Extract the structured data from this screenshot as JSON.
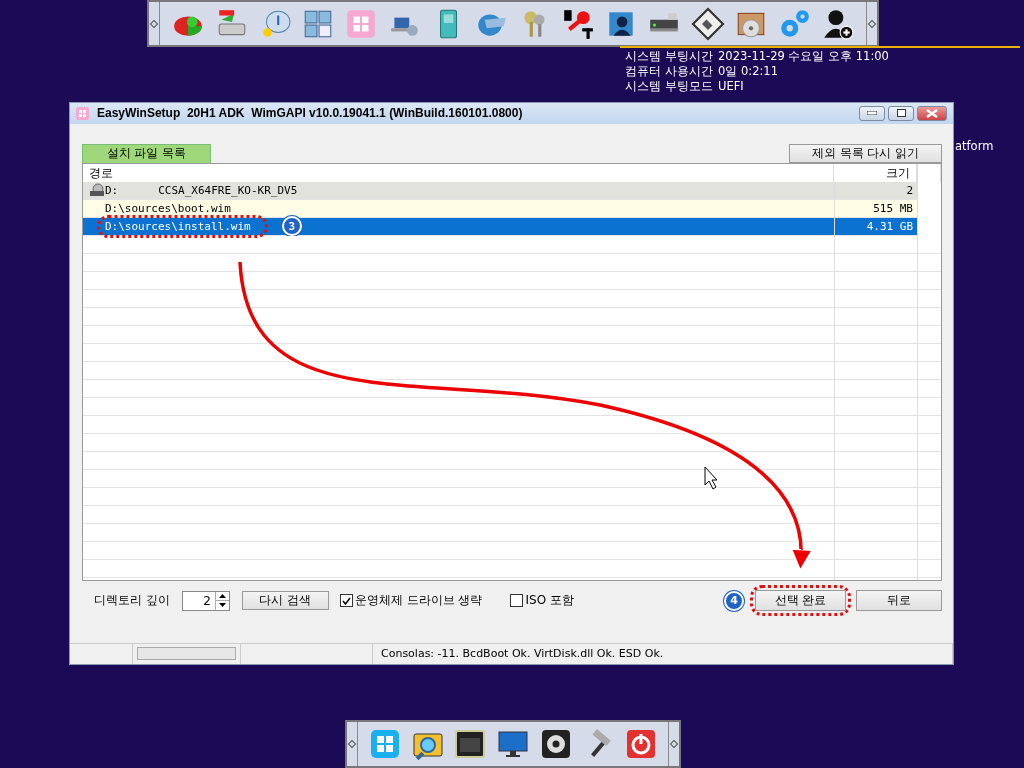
{
  "system_info": [
    {
      "label": "시스템 부팅시간",
      "value": "2023-11-29 수요일 오후 11:00"
    },
    {
      "label": "컴퓨터 사용시간",
      "value": "0일 0:2:11"
    },
    {
      "label": "시스템 부팅모드",
      "value": "UEFI"
    }
  ],
  "background_text": "atform",
  "window": {
    "title": "EasyWinSetup  20H1 ADK  WimGAPI v10.0.19041.1 (WinBuild.160101.0800)"
  },
  "tabs": [
    {
      "label": "설치 파일 목록",
      "selected": true
    }
  ],
  "reload_button": "제외 목록 다시 읽기",
  "table": {
    "columns": [
      "경로",
      "크기"
    ],
    "rows": [
      {
        "kind": "drive",
        "drive": "D:",
        "volume": "CCSA_X64FRE_KO-KR_DV5",
        "size": "2",
        "selected": false
      },
      {
        "kind": "file",
        "path": "D:\\sources\\boot.wim",
        "size": "515 MB",
        "selected": false
      },
      {
        "kind": "file",
        "path": "D:\\sources\\install.wim",
        "size": "4.31 GB",
        "selected": true
      }
    ]
  },
  "depth": {
    "label": "디렉토리 깊이",
    "value": "2"
  },
  "rescan_button": "다시 검색",
  "checkboxes": [
    {
      "label": "운영체제 드라이브 생략",
      "checked": true
    },
    {
      "label": "ISO 포함",
      "checked": false
    }
  ],
  "buttons": [
    {
      "label": "선택 완료"
    },
    {
      "label": "뒤로"
    }
  ],
  "callouts": [
    {
      "number": "3"
    },
    {
      "number": "4"
    }
  ],
  "status_bar": {
    "text": "Consolas: -11. BcdBoot Ok. VirtDisk.dll Ok. ESD Ok."
  }
}
